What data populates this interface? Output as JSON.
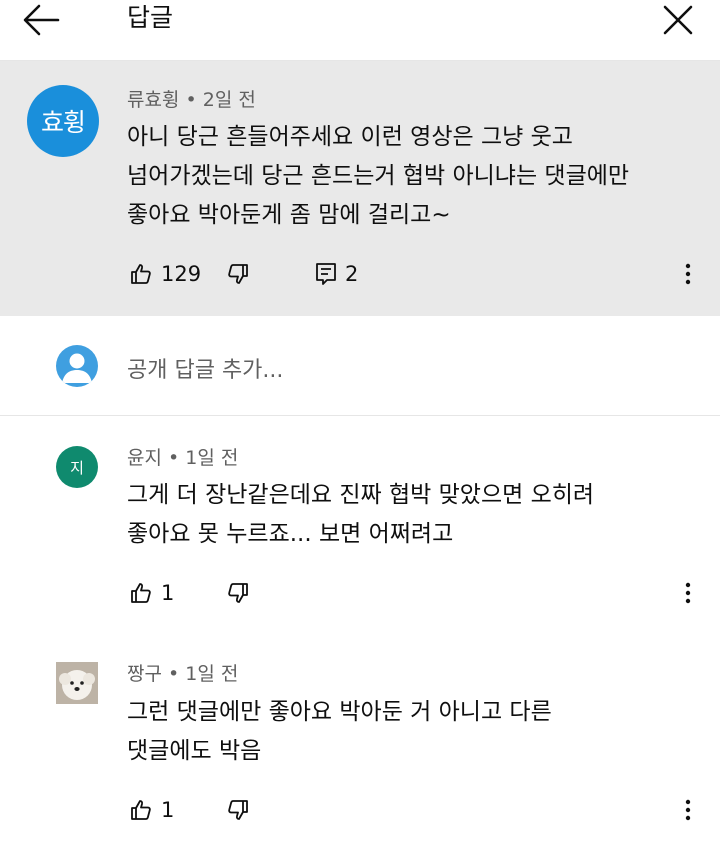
{
  "header": {
    "title": "답글",
    "back_icon": "arrow-left-icon",
    "close_icon": "close-icon"
  },
  "parent_comment": {
    "avatar_text": "효휭",
    "avatar_color": "#1a8fdb",
    "author": "류효휭",
    "time": "2일 전",
    "lines": [
      "아니 당근 흔들어주세요 이런 영상은 그냥 웃고",
      "넘어가겠는데 당근 흔드는거 협박 아니냐는 댓글에만",
      "좋아요 박아둔게 좀 맘에 걸리고~"
    ],
    "likes": "129",
    "replies": "2"
  },
  "reply_box": {
    "placeholder": "공개 답글 추가..."
  },
  "replies": [
    {
      "avatar_text": "지",
      "avatar_color": "#0f8a6e",
      "author": "윤지",
      "time": "1일 전",
      "lines": [
        "그게 더 장난같은데요 진짜 협박 맞았으면 오히려",
        "좋아요 못 누르죠... 보면 어쩌려고"
      ],
      "likes": "1"
    },
    {
      "avatar_text": "",
      "avatar_color": "#d8d2c8",
      "author": "짱구",
      "time": "1일 전",
      "lines": [
        "그런 댓글에만 좋아요 박아둔 거 아니고 다른",
        "댓글에도 박음"
      ],
      "likes": "1"
    }
  ],
  "separator": "•"
}
